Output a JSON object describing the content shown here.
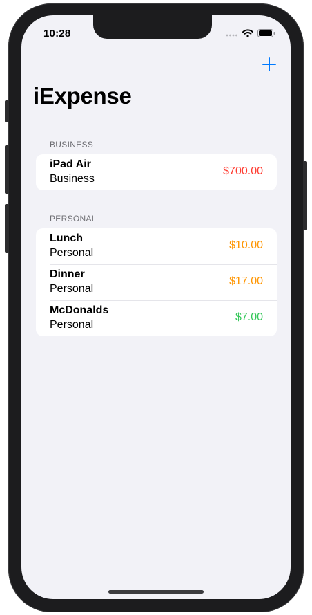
{
  "status_bar": {
    "time": "10:28"
  },
  "nav": {
    "title": "iExpense",
    "add_icon": "plus-icon",
    "accent_color": "#007aff"
  },
  "sections": [
    {
      "header": "BUSINESS",
      "items": [
        {
          "name": "iPad Air",
          "type": "Business",
          "amount": "$700.00",
          "color": "#ff3b30"
        }
      ]
    },
    {
      "header": "PERSONAL",
      "items": [
        {
          "name": "Lunch",
          "type": "Personal",
          "amount": "$10.00",
          "color": "#ff9500"
        },
        {
          "name": "Dinner",
          "type": "Personal",
          "amount": "$17.00",
          "color": "#ff9500"
        },
        {
          "name": "McDonalds",
          "type": "Personal",
          "amount": "$7.00",
          "color": "#34c759"
        }
      ]
    }
  ]
}
